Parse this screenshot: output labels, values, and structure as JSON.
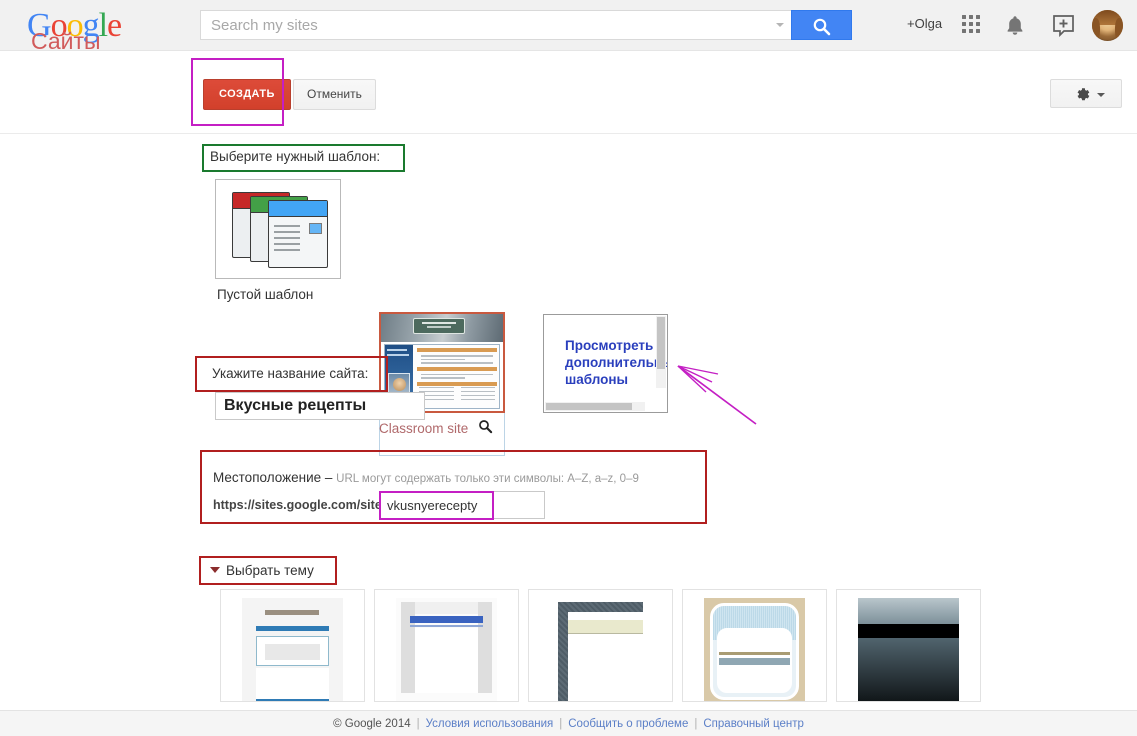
{
  "topbar": {
    "logo": "Google",
    "logo_letters": [
      "G",
      "o",
      "o",
      "g",
      "l",
      "e"
    ],
    "search_placeholder": "Search my sites",
    "search_value": "",
    "search_icon": "search-icon",
    "plus_user": "+Olga",
    "apps_icon": "apps-grid-icon",
    "bell_icon": "notifications-bell-icon",
    "share_icon": "add-to-box-icon",
    "avatar": "user-avatar"
  },
  "header": {
    "title": "Сайты",
    "create_label": "СОЗДАТЬ",
    "cancel_label": "Отменить",
    "settings_icon": "gear-icon"
  },
  "template_section": {
    "label": "Выберите нужный шаблон:",
    "items": [
      {
        "caption": "Пустой шаблон",
        "thumb": "stacked-pages-icon",
        "selected": false
      },
      {
        "caption": "Classroom site",
        "thumb": "classroom-site-preview",
        "selected": true,
        "zoom_icon": "magnifier-icon"
      },
      {
        "caption": "",
        "thumb": "more-templates-card",
        "link_text": "Просмотреть дополнительные шаблоны",
        "selected": false
      }
    ]
  },
  "name_section": {
    "label": "Укажите название сайта:",
    "value": "Вкусные рецепты",
    "placeholder": ""
  },
  "location_section": {
    "label": "Местоположение – ",
    "hint": "URL могут содержать только эти символы: A–Z, a–z, 0–9",
    "prefix": "https://sites.google.com/site/",
    "value": "vkusnyerecepty",
    "placeholder": ""
  },
  "theme_section": {
    "label": "Выбрать тему",
    "expand_icon": "triangle-down-icon",
    "themes": [
      {
        "name": "theme-light-blue"
      },
      {
        "name": "theme-columns-blue"
      },
      {
        "name": "theme-dark-frame-cream"
      },
      {
        "name": "theme-tan-rounded"
      },
      {
        "name": "theme-dark-gradient"
      }
    ]
  },
  "footer": {
    "copyright": "© Google 2014",
    "links": [
      "Условия использования",
      "Сообщить о проблеме",
      "Справочный центр"
    ],
    "separator": "|"
  },
  "annotations": {
    "create_box": "magenta",
    "template_label_box": "green",
    "name_label_box": "red",
    "location_box": "red",
    "url_input_box": "magenta",
    "theme_label_box": "red",
    "arrow": "magenta-arrow-to-more-templates"
  },
  "colors": {
    "accent_red": "#d9452e",
    "title_red": "#d15b5b",
    "link_blue": "#2a3fbd",
    "search_blue": "#4285f4",
    "anno_magenta": "#c41fc4",
    "anno_green": "#1a7a2e",
    "anno_red": "#b11f1f"
  }
}
